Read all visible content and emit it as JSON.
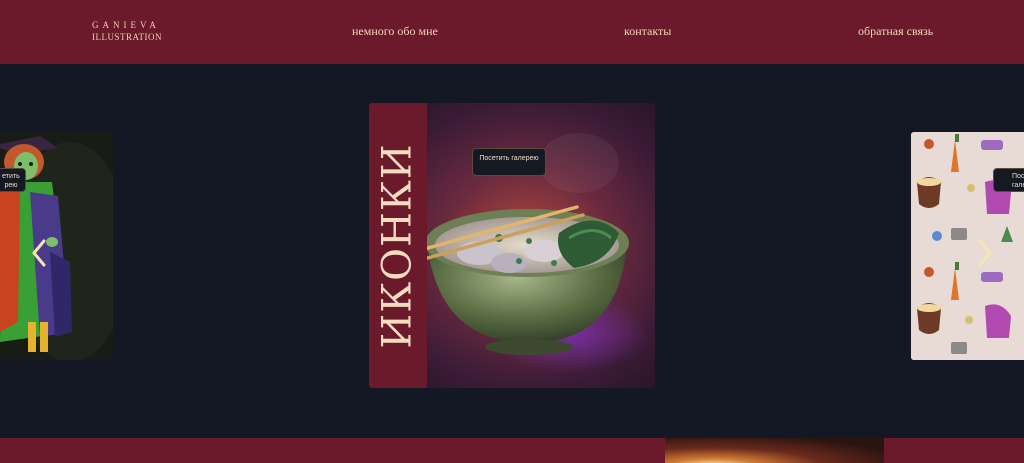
{
  "header": {
    "logo_line1": "GANIEVA",
    "logo_line2": "ILLUSTRATION",
    "nav": [
      "немного обо мне",
      "контакты",
      "обратная связь"
    ]
  },
  "carousel": {
    "center_title": "ИКОНКИ",
    "visit_button": "Посетить галерею",
    "left_button_fragment": "етить\nрею",
    "right_button_fragment": "Посе\nгале"
  },
  "icons": {
    "prev": "chevron-left-icon",
    "next": "chevron-right-icon"
  },
  "colors": {
    "header_bg": "#6a1a2b",
    "page_bg": "#141824",
    "text_accent": "#f2d6b5"
  }
}
